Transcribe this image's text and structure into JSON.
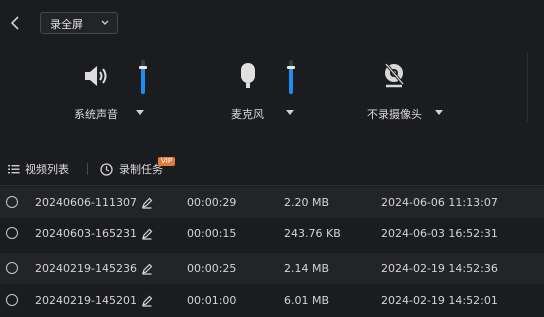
{
  "header": {
    "back_icon": "chevron-left-icon",
    "mode_select": {
      "value": "录全屏",
      "icon": "chevron-down-icon"
    }
  },
  "controls": {
    "system_audio": {
      "label": "系统声音",
      "icon": "speaker-icon",
      "volume_level": 0.8
    },
    "microphone": {
      "label": "麦克风",
      "icon": "microphone-icon",
      "volume_level": 0.8
    },
    "camera": {
      "label": "不录摄像头",
      "icon": "camera-off-icon"
    }
  },
  "tabs": [
    {
      "label": "视频列表",
      "icon": "list-icon"
    },
    {
      "label": "录制任务",
      "icon": "clock-icon",
      "badge": "VIP"
    }
  ],
  "recordings": [
    {
      "name": "20240606-111307",
      "duration": "00:00:29",
      "size": "2.20 MB",
      "date": "2024-06-06 11:13:07"
    },
    {
      "name": "20240603-165231",
      "duration": "00:00:15",
      "size": "243.76 KB",
      "date": "2024-06-03 16:52:31"
    },
    {
      "name": "20240219-145236",
      "duration": "00:00:25",
      "size": "2.14 MB",
      "date": "2024-02-19 14:52:36"
    },
    {
      "name": "20240219-145201",
      "duration": "00:01:00",
      "size": "6.01 MB",
      "date": "2024-02-19 14:52:01"
    }
  ],
  "colors": {
    "accent": "#1e8cf0",
    "vip": "#e07b3b",
    "background": "#1b1c1f"
  }
}
